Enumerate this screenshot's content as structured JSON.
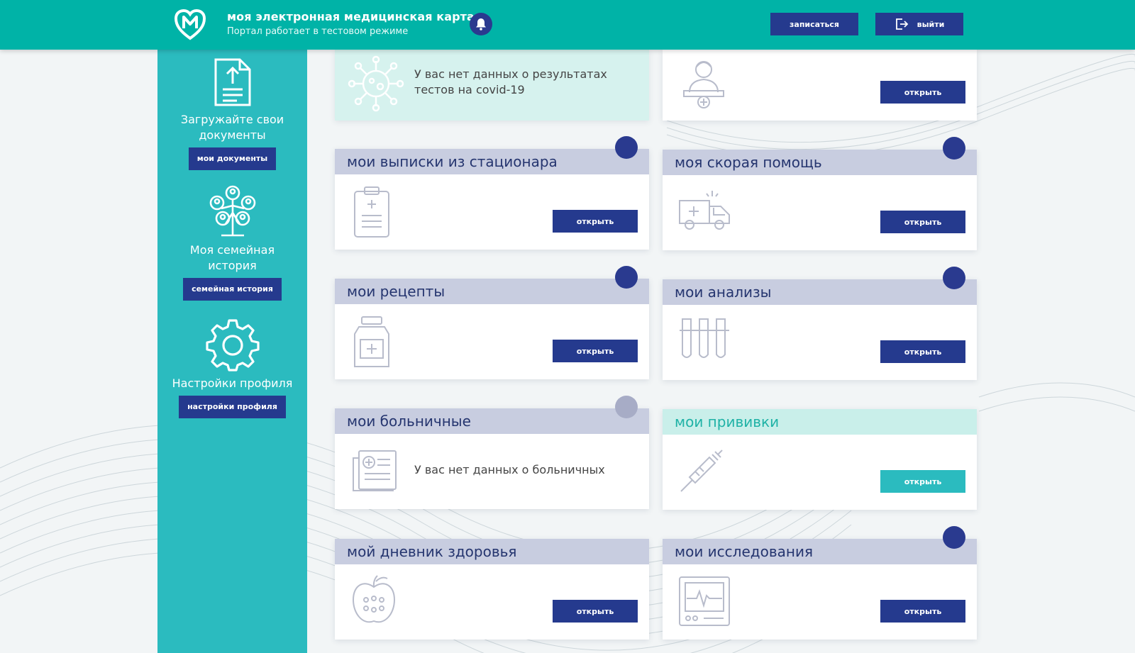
{
  "header": {
    "title": "моя электронная медицинская карта",
    "subtitle": "Портал работает в тестовом режиме",
    "appoint_label": "записаться",
    "logout_label": "выйти"
  },
  "sidebar": {
    "items": [
      {
        "label": "Загружайте свои документы",
        "button": "мои документы",
        "icon": "document-upload-icon"
      },
      {
        "label": "Моя семейная история",
        "button": "семейная история",
        "icon": "family-tree-icon"
      },
      {
        "label": "Настройки профиля",
        "button": "настройки профиля",
        "icon": "gear-icon"
      }
    ]
  },
  "covid": {
    "message": "У вас нет данных о результатах тестов на covid-19",
    "icon": "virus-icon"
  },
  "top_right": {
    "open_label": "открыть",
    "icon": "doctor-icon"
  },
  "cards": [
    {
      "title": "мои выписки из стационара",
      "open_label": "открыть",
      "icon": "clipboard-icon"
    },
    {
      "title": "моя скорая помощь",
      "open_label": "открыть",
      "icon": "ambulance-icon"
    },
    {
      "title": "мои рецепты",
      "open_label": "открыть",
      "icon": "medicine-bottle-icon"
    },
    {
      "title": "мои анализы",
      "open_label": "открыть",
      "icon": "test-tubes-icon"
    },
    {
      "title": "мои больничные",
      "message": "У вас нет данных о больничных",
      "icon": "sick-leave-icon"
    },
    {
      "title": "мои прививки",
      "open_label": "открыть",
      "icon": "syringe-icon"
    },
    {
      "title": "мой дневник здоровья",
      "open_label": "открыть",
      "icon": "apple-icon"
    },
    {
      "title": "мои исследования",
      "open_label": "открыть",
      "icon": "monitor-ecg-icon"
    }
  ],
  "colors": {
    "header_bg": "#00b3a7",
    "sidebar_bg": "#2bbbbf",
    "button_dark": "#253a8e",
    "card_head": "#c8cde0",
    "accent_teal": "#1fb2a6"
  }
}
